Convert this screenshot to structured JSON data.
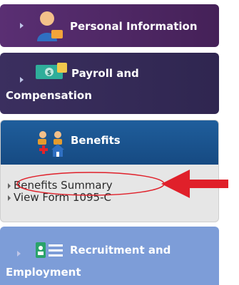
{
  "menu": {
    "personal": {
      "label": "Personal Information",
      "icon": "person-icon"
    },
    "payroll": {
      "line1": "Payroll and",
      "line2": "Compensation",
      "icon": "money-icon"
    },
    "benefits": {
      "label": "Benefits",
      "icon": "family-house-icon",
      "items": [
        {
          "label": "Benefits Summary"
        },
        {
          "label": "View Form 1095-C"
        }
      ]
    },
    "recruitment": {
      "line1": "Recruitment and",
      "line2": "Employment",
      "icon": "id-card-icon"
    }
  },
  "colors": {
    "highlight_oval": "#e0202a",
    "arrow": "#e0202a"
  }
}
